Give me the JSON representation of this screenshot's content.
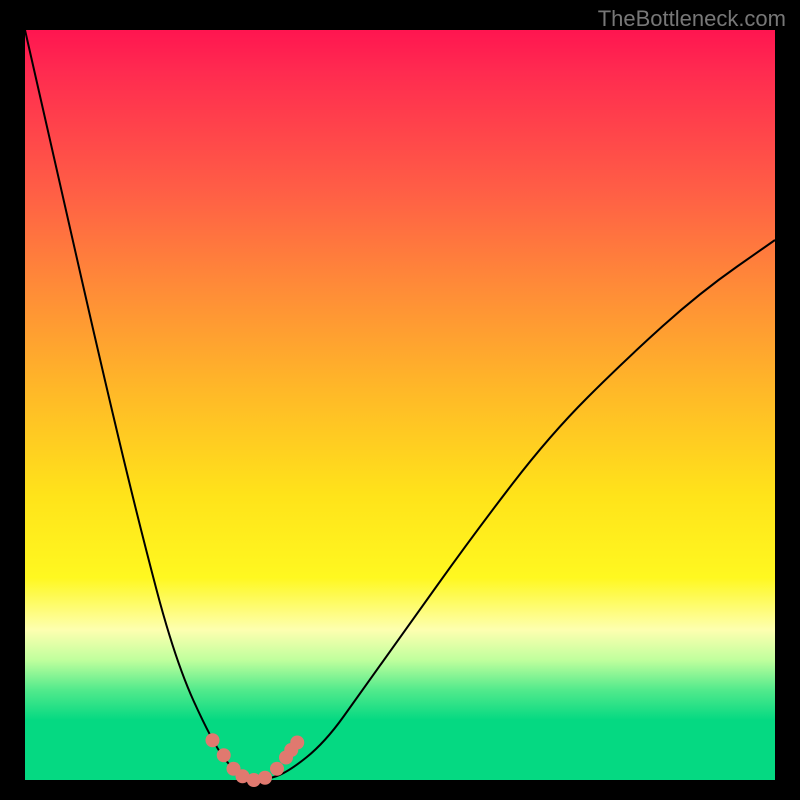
{
  "watermark": "TheBottleneck.com",
  "chart_data": {
    "type": "line",
    "title": "",
    "xlabel": "",
    "ylabel": "",
    "x": [
      0.0,
      0.05,
      0.1,
      0.15,
      0.2,
      0.25,
      0.28,
      0.3,
      0.32,
      0.35,
      0.4,
      0.45,
      0.5,
      0.6,
      0.7,
      0.8,
      0.9,
      1.0
    ],
    "values": [
      1.0,
      0.78,
      0.56,
      0.35,
      0.16,
      0.05,
      0.01,
      0.0,
      0.0,
      0.01,
      0.05,
      0.12,
      0.19,
      0.33,
      0.46,
      0.56,
      0.65,
      0.72
    ],
    "ylim": [
      0,
      1
    ],
    "marker_points_x": [
      0.25,
      0.265,
      0.278,
      0.29,
      0.305,
      0.32,
      0.336,
      0.348,
      0.355,
      0.363
    ],
    "marker_points_y": [
      0.053,
      0.033,
      0.015,
      0.005,
      0.0,
      0.003,
      0.015,
      0.03,
      0.04,
      0.05
    ]
  },
  "colors": {
    "curve": "#000000",
    "marker": "#e0796f"
  }
}
